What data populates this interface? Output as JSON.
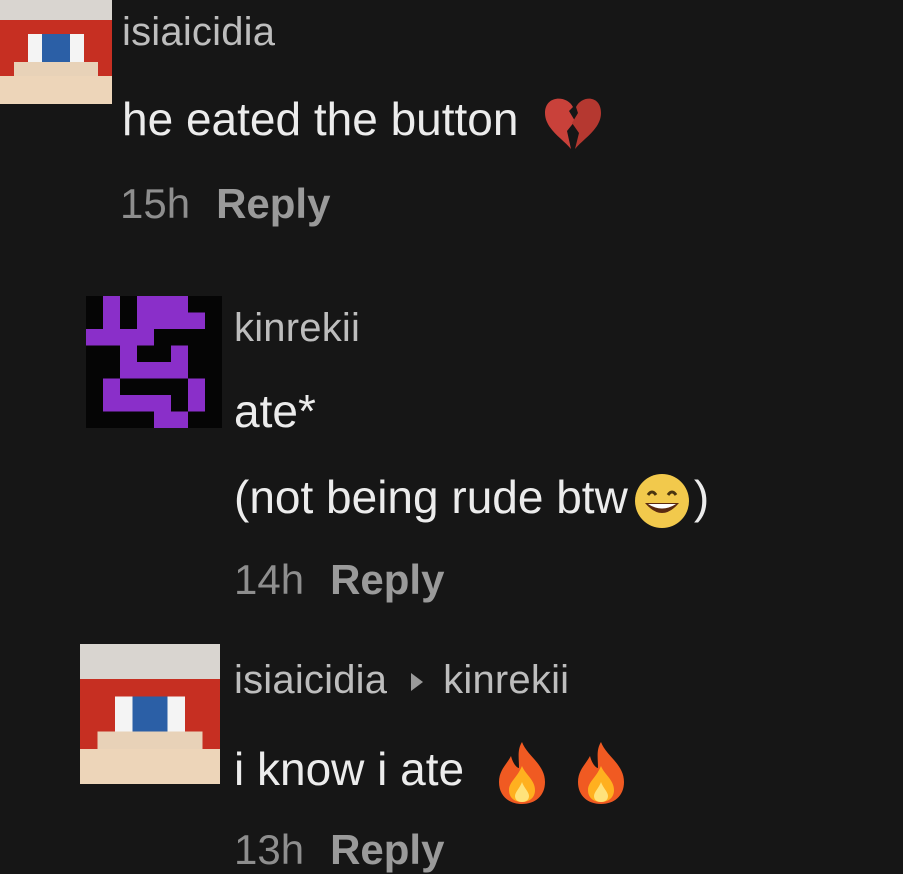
{
  "comments": [
    {
      "username": "isiaicidia",
      "lines": [
        "he eated the button"
      ],
      "emoji": "broken-heart-icon",
      "time": "15h",
      "reply_label": "Reply"
    },
    {
      "username": "kinrekii",
      "lines": [
        "ate*",
        "(not being rude btw",
        ")"
      ],
      "emoji": "grinning-face-icon",
      "time": "14h",
      "reply_label": "Reply"
    },
    {
      "username": "isiaicidia",
      "reply_to": "kinrekii",
      "lines": [
        "i know i ate"
      ],
      "emoji": "fire-icon",
      "time": "13h",
      "reply_label": "Reply"
    }
  ],
  "colors": {
    "background": "#161616",
    "username": "#bdbdbd",
    "text": "#ececec",
    "meta": "#8e8e8e",
    "avatar_purple": "#8a2fc9"
  }
}
